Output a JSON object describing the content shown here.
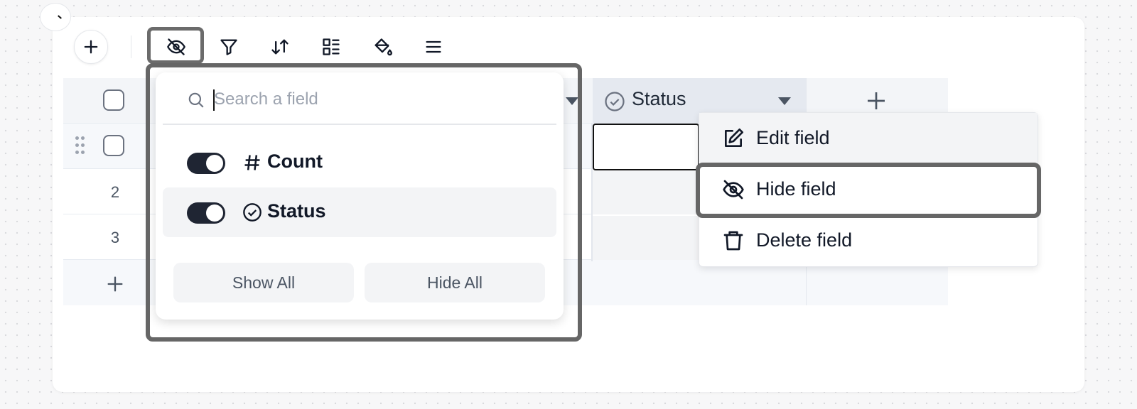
{
  "toolbar": {
    "icons": [
      "plus-icon",
      "eye-off-icon",
      "filter-icon",
      "sort-icon",
      "group-icon",
      "paint-bucket-icon",
      "menu-icon"
    ]
  },
  "grid": {
    "status_header": "Status",
    "row_numbers": [
      "2",
      "3"
    ]
  },
  "hide_fields_popover": {
    "search_placeholder": "Search a field",
    "fields": [
      {
        "label": "Count",
        "icon": "hash-icon",
        "visible": true
      },
      {
        "label": "Status",
        "icon": "circle-check-icon",
        "visible": true
      }
    ],
    "show_all_label": "Show All",
    "hide_all_label": "Hide All"
  },
  "field_menu": {
    "items": [
      {
        "label": "Edit field",
        "icon": "edit-icon"
      },
      {
        "label": "Hide field",
        "icon": "eye-off-icon"
      },
      {
        "label": "Delete field",
        "icon": "trash-icon"
      }
    ]
  },
  "colors": {
    "toggle_on": "#1f2533",
    "highlight_outline": "#666666",
    "header_bg": "#e5e9f0"
  }
}
